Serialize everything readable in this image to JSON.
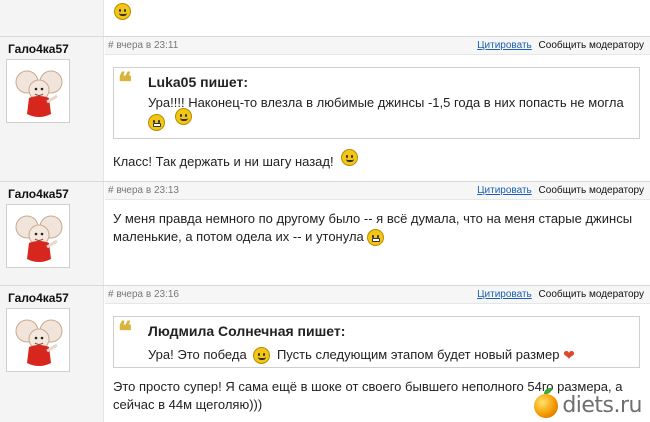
{
  "posts": [
    {
      "author": "Гало4ка57",
      "date": "# вчера в 23:11",
      "quote_link": "Цитировать",
      "report_link": "Сообщить модератору",
      "quote": {
        "author": "Luka05 пишет:",
        "text": "Ура!!!! Наконец-то влезла в любимые джинсы -1,5 года в них попасть не могла"
      },
      "text": "Класс! Так держать и ни шагу назад!"
    },
    {
      "author": "Гало4ка57",
      "date": "# вчера в 23:13",
      "quote_link": "Цитировать",
      "report_link": "Сообщить модератору",
      "text": "У меня правда немного по другому было -- я всё думала, что на меня старые джинсы маленькие, а потом одела их -- и утонула"
    },
    {
      "author": "Гало4ка57",
      "date": "# вчера в 23:16",
      "quote_link": "Цитировать",
      "report_link": "Сообщить модератору",
      "quote": {
        "author": "Людмила Солнечная пишет:",
        "text_part1": "Ура! Это победа",
        "text_part2": "Пусть следующим этапом будет новый размер"
      },
      "text": "Это просто супер! Я сама ещё в шоке от своего бывшего неполного 54го размера, а сейчас в 44м щеголяю)))"
    }
  ],
  "watermark": "diets.ru",
  "icons": {
    "quote_mark": "❝",
    "heart": "❤"
  },
  "colors": {
    "link": "#1a5fb4",
    "quote_mark": "#d9b33c",
    "author_bg": "#f4f4f4"
  }
}
